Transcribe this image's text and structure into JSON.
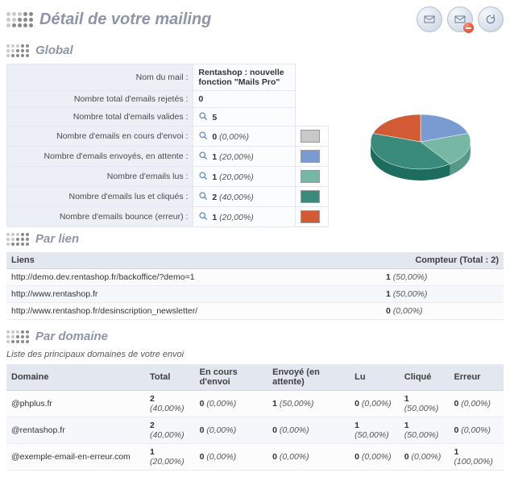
{
  "header": {
    "title": "Détail de votre mailing"
  },
  "global": {
    "heading": "Global",
    "rows": [
      {
        "label": "Nom du mail :",
        "value": "Rentashop : nouvelle fonction \"Mails Pro\"",
        "has_icon": false,
        "has_swatch": false
      },
      {
        "label": "Nombre total d'emails rejetés :",
        "value": "0",
        "has_icon": false,
        "has_swatch": false
      },
      {
        "label": "Nombre total d'emails valides :",
        "value": "5",
        "has_icon": true,
        "has_swatch": false
      },
      {
        "label": "Nombre d'emails en cours d'envoi :",
        "value": "0",
        "pct": "(0,00%)",
        "has_icon": true,
        "has_swatch": true,
        "swatch": "#c9c9c9"
      },
      {
        "label": "Nombre d'emails envoyés, en attente :",
        "value": "1",
        "pct": "(20,00%)",
        "has_icon": true,
        "has_swatch": true,
        "swatch": "#7a9bd1"
      },
      {
        "label": "Nombre d'emails lus :",
        "value": "1",
        "pct": "(20,00%)",
        "has_icon": true,
        "has_swatch": true,
        "swatch": "#77b7a5"
      },
      {
        "label": "Nombre d'emails lus et cliqués :",
        "value": "2",
        "pct": "(40,00%)",
        "has_icon": true,
        "has_swatch": true,
        "swatch": "#3b8b7d"
      },
      {
        "label": "Nombre d'emails bounce (erreur) :",
        "value": "1",
        "pct": "(20,00%)",
        "has_icon": true,
        "has_swatch": true,
        "swatch": "#d25b34"
      }
    ]
  },
  "par_lien": {
    "heading": "Par lien",
    "col_links": "Liens",
    "col_counter": "Compteur (Total : 2)",
    "rows": [
      {
        "url": "http://demo.dev.rentashop.fr/backoffice/?demo=1",
        "count": "1",
        "pct": "(50,00%)"
      },
      {
        "url": "http://www.rentashop.fr",
        "count": "1",
        "pct": "(50,00%)"
      },
      {
        "url": "http://www.rentashop.fr/desinscription_newsletter/",
        "count": "0",
        "pct": "(0,00%)"
      }
    ]
  },
  "par_domaine": {
    "heading": "Par domaine",
    "subtitle": "Liste des principaux domaines de votre envoi",
    "cols": {
      "domain": "Domaine",
      "total": "Total",
      "sending": "En cours d'envoi",
      "sent": "Envoyé (en attente)",
      "read": "Lu",
      "clicked": "Cliqué",
      "error": "Erreur"
    },
    "rows": [
      {
        "domain": "@phplus.fr",
        "total": "2",
        "total_pct": "(40,00%)",
        "sending": "0",
        "sending_pct": "(0,00%)",
        "sent": "1",
        "sent_pct": "(50,00%)",
        "read": "0",
        "read_pct": "(0,00%)",
        "clicked": "1",
        "clicked_pct": "(50,00%)",
        "error": "0",
        "error_pct": "(0,00%)"
      },
      {
        "domain": "@rentashop.fr",
        "total": "2",
        "total_pct": "(40,00%)",
        "sending": "0",
        "sending_pct": "(0,00%)",
        "sent": "0",
        "sent_pct": "(0,00%)",
        "read": "1",
        "read_pct": "(50,00%)",
        "clicked": "1",
        "clicked_pct": "(50,00%)",
        "error": "0",
        "error_pct": "(0,00%)"
      },
      {
        "domain": "@exemple-email-en-erreur.com",
        "total": "1",
        "total_pct": "(20,00%)",
        "sending": "0",
        "sending_pct": "(0,00%)",
        "sent": "0",
        "sent_pct": "(0,00%)",
        "read": "0",
        "read_pct": "(0,00%)",
        "clicked": "0",
        "clicked_pct": "(0,00%)",
        "error": "1",
        "error_pct": "(100,00%)"
      }
    ]
  },
  "chart_data": {
    "type": "pie",
    "title": "",
    "slices": [
      {
        "name": "Envoyés, en attente",
        "value": 20,
        "color": "#7a9bd1"
      },
      {
        "name": "Lus",
        "value": 20,
        "color": "#77b7a5"
      },
      {
        "name": "Lus et cliqués",
        "value": 40,
        "color": "#3b8b7d"
      },
      {
        "name": "Bounce (erreur)",
        "value": 20,
        "color": "#d25b34"
      }
    ],
    "total": 5
  }
}
